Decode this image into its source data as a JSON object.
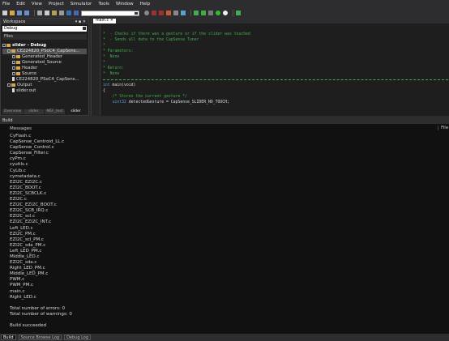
{
  "menubar": {
    "items": [
      "File",
      "Edit",
      "View",
      "Project",
      "Simulator",
      "Tools",
      "Window",
      "Help"
    ]
  },
  "toolbar": {
    "icons": [
      "new-file-icon",
      "open-icon",
      "save-icon",
      "save-all-icon",
      "cut-icon",
      "copy-icon",
      "paste-icon",
      "print-icon",
      "undo-icon",
      "redo-icon",
      "find-icon",
      "build-icon",
      "clean-icon",
      "program-icon",
      "debug-icon",
      "run-icon",
      "stop-icon",
      "step-icon"
    ]
  },
  "workspace": {
    "title": "Workspace",
    "config": "Debug",
    "files_header": "Files",
    "tree": [
      {
        "label": "slider - Debug",
        "type": "project",
        "indent": 0
      },
      {
        "label": "CE224820_PSoC4_CapSens...",
        "type": "folder",
        "indent": 1,
        "selected": true
      },
      {
        "label": "Generated_Header",
        "type": "folder",
        "indent": 2
      },
      {
        "label": "Generated_Source",
        "type": "folder",
        "indent": 2
      },
      {
        "label": "Header",
        "type": "folder",
        "indent": 2
      },
      {
        "label": "Source",
        "type": "folder",
        "indent": 2
      },
      {
        "label": "CE224820_PSoC4_CapSens...",
        "type": "file",
        "indent": 2
      },
      {
        "label": "Output",
        "type": "folder",
        "indent": 1
      },
      {
        "label": "slider.out",
        "type": "file",
        "indent": 2
      }
    ],
    "tabs": [
      "Overview",
      "slider",
      "MEF_test",
      "slider"
    ]
  },
  "editor": {
    "tab_label": "main.c",
    "code": [
      {
        "text": "*  - Checks if there was a gesture or if the slider was touched",
        "kind": "comment"
      },
      {
        "text": "*  - Sends all data to the CapSense Tuner",
        "kind": "comment"
      },
      {
        "text": "*",
        "kind": "comment"
      },
      {
        "text": "* Parameters:",
        "kind": "comment"
      },
      {
        "text": "*  None",
        "kind": "comment"
      },
      {
        "text": "*",
        "kind": "comment"
      },
      {
        "text": "* Return:",
        "kind": "comment"
      },
      {
        "text": "*  None",
        "kind": "comment"
      },
      {
        "text": "*",
        "kind": "dashed"
      },
      {
        "text": "int main(void)",
        "kind": "code"
      },
      {
        "text": "{",
        "kind": "code"
      },
      {
        "text": "    /* Stores the current gesture */",
        "kind": "comment"
      },
      {
        "text": "    uint32 detectedGesture = CapSense_SLIDER_NO_TOUCH;",
        "kind": "code"
      }
    ]
  },
  "build": {
    "title": "Build",
    "col_messages": "Messages",
    "col_file": "File",
    "messages": [
      "CyFlash.c",
      "CapSense_Centroid_LL.c",
      "CapSense_Control.c",
      "CapSense_Filter.c",
      "cyPm.c",
      "cyutils.c",
      "CyLib.c",
      "cymetadata.c",
      "EZI2C_EZI2C.c",
      "EZI2C_BOOT.c",
      "EZI2C_SCBCLK.c",
      "EZI2C.c",
      "EZI2C_EZI2C_BOOT.c",
      "EZI2C_SCB_IRQ.c",
      "EZI2C_scl.c",
      "EZI2C_EZI2C_INT.c",
      "Left_LED.c",
      "EZI2C_PM.c",
      "EZI2C_scl_PM.c",
      "EZI2C_sda_PM.c",
      "Left_LED_PM.c",
      "Middle_LED.c",
      "EZI2C_sda.c",
      "Right_LED_PM.c",
      "Middle_LED_PM.c",
      "PWM.c",
      "PWM_PM.c",
      "main.c",
      "Right_LED.c",
      "",
      "Total number of errors: 0",
      "Total number of warnings: 0",
      "",
      "Build succeeded"
    ]
  },
  "bottom_tabs": [
    "Build",
    "Source Browse Log",
    "Debug Log"
  ]
}
